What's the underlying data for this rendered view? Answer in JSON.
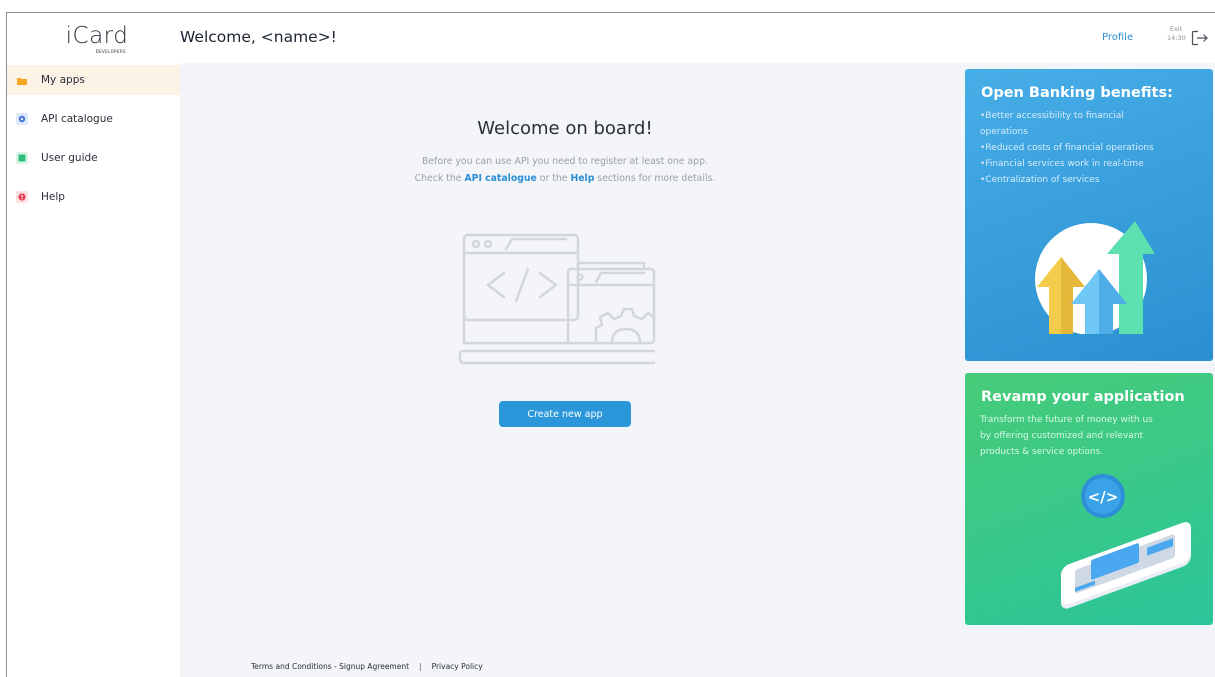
{
  "header": {
    "logo_text": "iCard",
    "logo_sub": "DEVELOPERS",
    "welcome": "Welcome, <name>!",
    "profile_label": "Profile",
    "exit_label": "Exit",
    "exit_time": "14:30"
  },
  "sidebar": {
    "items": [
      {
        "label": "My apps",
        "icon": "folder-icon",
        "color": "#f5a623",
        "active": true
      },
      {
        "label": "API catalogue",
        "icon": "gear-icon",
        "color": "#3d6fd6",
        "active": false
      },
      {
        "label": "User guide",
        "icon": "book-icon",
        "color": "#2bbf7a",
        "active": false
      },
      {
        "label": "Help",
        "icon": "help-icon",
        "color": "#e53950",
        "active": false
      }
    ]
  },
  "main": {
    "title": "Welcome on board!",
    "line1": "Before you can use API you need to register at least one app.",
    "line2_pre": "Check the ",
    "line2_link1": "API catalogue",
    "line2_mid": " or the ",
    "line2_link2": "Help",
    "line2_post": " sections for more details.",
    "create_button": "Create new app",
    "illustration_icon": "code-window-icon"
  },
  "footer": {
    "terms": "Terms and Conditions - Signup Agreement",
    "separator": "|",
    "privacy": "Privacy Policy"
  },
  "cards": {
    "open_banking": {
      "title": "Open Banking benefits:",
      "items": [
        "•Better accessibility to financial",
        "operations",
        "•Reduced costs of financial operations",
        "•Financial services work in real-time",
        "•Centralization of services"
      ],
      "icon": "growth-arrows-icon",
      "color": "#3aa3e0"
    },
    "revamp": {
      "title": "Revamp your application",
      "lines": [
        "Transform the future of money with us",
        "by offering customized and relevant",
        "products & service options."
      ],
      "icon": "mobile-code-icon",
      "color": "#3dc983"
    }
  },
  "colors": {
    "accent": "#2b96d9",
    "active_nav": "#fdf2e6",
    "background": "#f4f5f8"
  }
}
